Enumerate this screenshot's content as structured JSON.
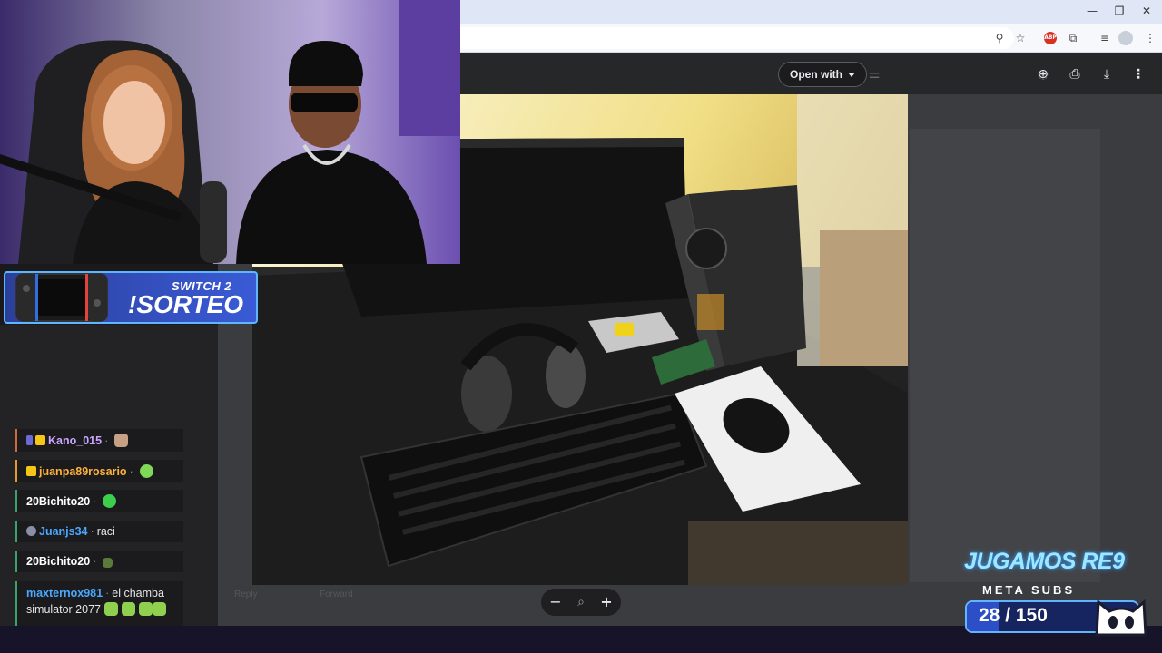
{
  "browser": {
    "window_controls": {
      "minimize": "—",
      "restore": "❐",
      "close": "✕"
    },
    "toolbar_icons": [
      "zoom-icon",
      "star-icon",
      "extension-red-icon",
      "extensions-icon",
      "tab-search-icon",
      "profile-icon",
      "menu-icon"
    ]
  },
  "viewer": {
    "open_with_label": "Open with",
    "zoom_out": "−",
    "zoom_icon": "⌕",
    "zoom_in": "+",
    "footer_reply": "Reply",
    "footer_forward": "Forward"
  },
  "overlay": {
    "sorteo_small": "SWITCH 2",
    "sorteo_big": "!SORTEO"
  },
  "chat": {
    "messages": [
      {
        "user": "Kano_015",
        "text": "",
        "user_color": "#c9a6ff"
      },
      {
        "user": "juanpa89rosario",
        "text": "",
        "user_color": "#ffb13b"
      },
      {
        "user": "20Bichito20",
        "text": "",
        "user_color": "#ffffff"
      },
      {
        "user": "Juanjs34",
        "text": "raci",
        "user_color": "#4aa8ff"
      },
      {
        "user": "20Bichito20",
        "text": "",
        "user_color": "#ffffff"
      },
      {
        "user": "maxternox981",
        "text": "el chamba simulator 2077",
        "user_color": "#4aa8ff"
      }
    ]
  },
  "sub_goal": {
    "title": "JUGAMOS RE9",
    "label": "META SUBS",
    "count": "28 / 150",
    "current": 28,
    "target": 150
  },
  "colors": {
    "accent_blue": "#5fb6ff",
    "chat_bg": "#232326",
    "viewer_bg": "#3b3c3f"
  }
}
